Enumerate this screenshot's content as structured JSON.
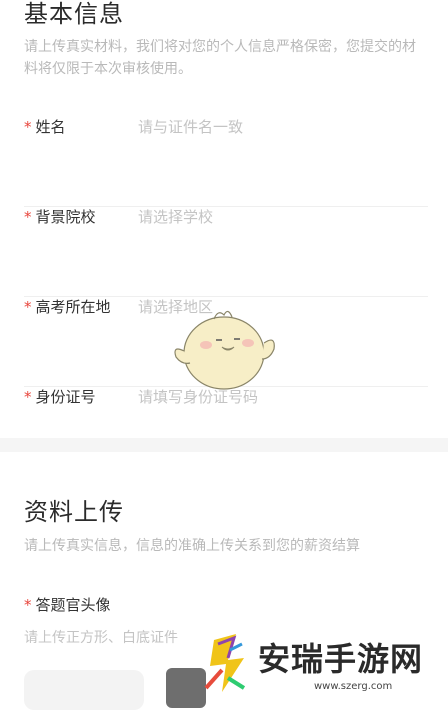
{
  "basic": {
    "title": "基本信息",
    "desc": "请上传真实材料，我们将对您的个人信息严格保密，您提交的材料将仅限于本次审核使用。",
    "fields": [
      {
        "label": "姓名",
        "placeholder": "请与证件名一致"
      },
      {
        "label": "背景院校",
        "placeholder": "请选择学校"
      },
      {
        "label": "高考所在地",
        "placeholder": "请选择地区"
      },
      {
        "label": "身份证号",
        "placeholder": "请填写身份证号码"
      }
    ]
  },
  "upload": {
    "title": "资料上传",
    "desc": "请上传真实信息，信息的准确上传关系到您的薪资结算",
    "avatar_label": "答题官头像",
    "avatar_hint": "请上传正方形、白底证件"
  },
  "required_mark": "*",
  "watermark": {
    "text": "安瑞手游网",
    "url": "www.szerg.com"
  },
  "colors": {
    "required": "#e8453c",
    "placeholder": "#c4c4c4",
    "title": "#2b2b2b"
  }
}
